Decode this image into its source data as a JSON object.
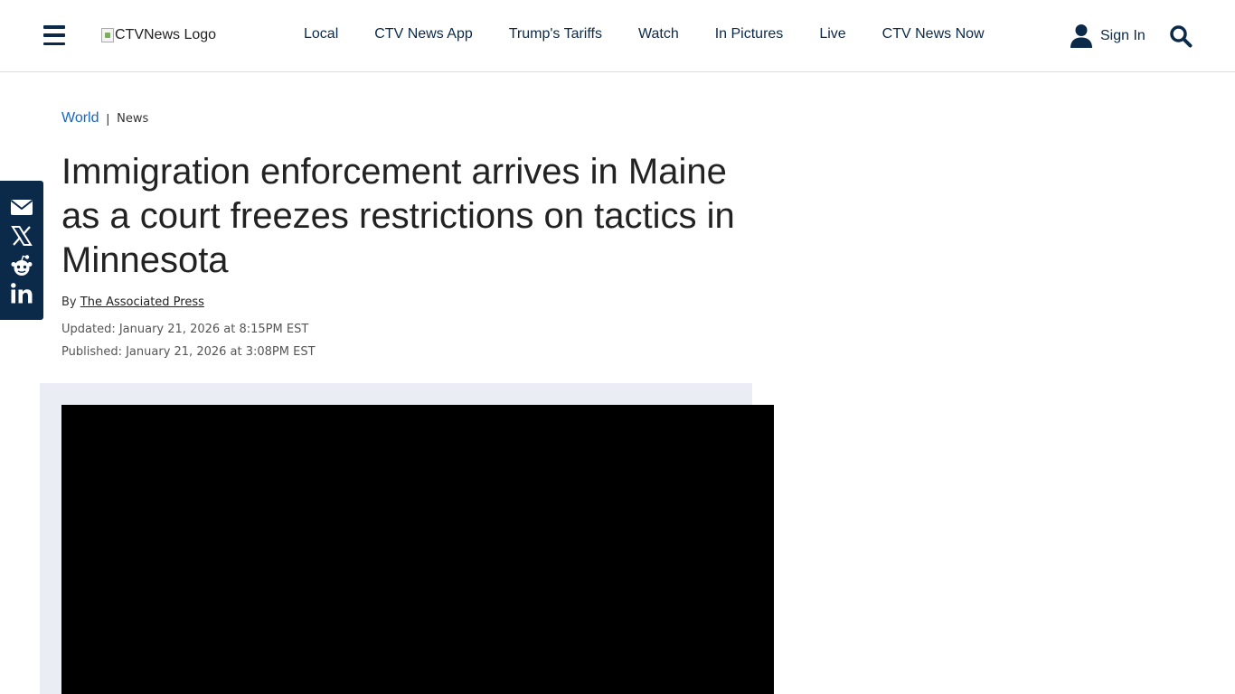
{
  "header": {
    "logo_alt": "CTVNews Logo",
    "nav": [
      "Local",
      "CTV News App",
      "Trump's Tariffs",
      "Watch",
      "In Pictures",
      "Live",
      "CTV News Now"
    ],
    "sign_in": "Sign In"
  },
  "icons": {
    "menu": "hamburger-menu-icon",
    "user": "user-icon",
    "search": "search-icon",
    "share": [
      "email-icon",
      "x-icon",
      "reddit-icon",
      "linkedin-icon"
    ]
  },
  "article": {
    "breadcrumb": {
      "section": "World",
      "separator": "|",
      "subsection": "News"
    },
    "headline": "Immigration enforcement arrives in Maine as a court freezes restrictions on tactics in Minnesota",
    "byline_prefix": "By",
    "author": "The Associated Press",
    "updated": "Updated: January 21, 2026 at 8:15PM EST",
    "published": "Published: January 21, 2026 at 3:08PM EST"
  },
  "colors": {
    "navy": "#0b2a4a",
    "link_blue": "#1a66c2",
    "media_bg": "#eaeef4"
  }
}
